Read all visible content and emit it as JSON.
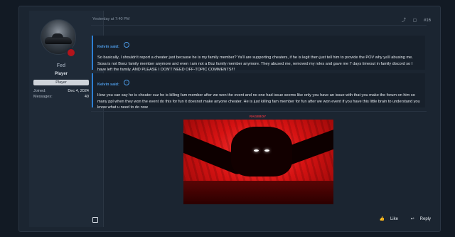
{
  "user": {
    "name": "Fed",
    "title": "Player",
    "banner": "Player",
    "stats": [
      {
        "label": "Joined:",
        "value": "Dec 4, 2024"
      },
      {
        "label": "Messages:",
        "value": "40"
      }
    ]
  },
  "post": {
    "timestamp": "Yesterday at 7:40 PM",
    "number": "#16",
    "share_icon": "share-icon",
    "bookmark_icon": "bookmark-icon",
    "quotes": [
      {
        "author": "Kelvin said:",
        "text": "So basically, I shouldn't report a cheater just because he is my family member? Ya'll are supporting cheaters, if he is legit then just tell him to provide the POV why ya'll abusing me. Sosa is not Bonz family member anymore and even i am not a Boz family member anymore. They abused me, removed my roles and gave me 7 days timeout in family discord so I have left the family. AND PLEASE I DON'T NEED OFF-TOPIC COMMENTS!!!"
      },
      {
        "author": "Kelvin said:",
        "text": "How you can say he is cheater cuz he is killing fam member after we won the event and no one had issue seems like only you have an issue with that you make the forum on him so many ppl when they won the event do this for fun it doesnot make anyone cheater. He is just killing fam member for fun after we won event if you have this little brain to understand you know what u need to do now"
      }
    ],
    "image_label": "RAGEBOY",
    "like_label": "Like",
    "reply_label": "Reply"
  }
}
